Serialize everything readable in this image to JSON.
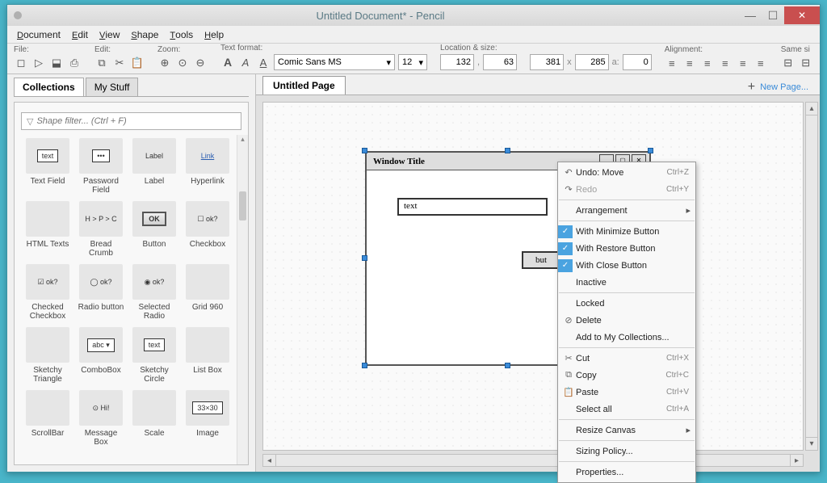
{
  "title": "Untitled Document* - Pencil",
  "menubar": [
    "Document",
    "Edit",
    "View",
    "Shape",
    "Tools",
    "Help"
  ],
  "toolbar": {
    "groups": {
      "file": "File:",
      "edit": "Edit:",
      "zoom": "Zoom:",
      "text": "Text format:",
      "location": "Location & size:",
      "alignment": "Alignment:",
      "samesize": "Same si"
    },
    "font": "Comic Sans MS",
    "fontsize": "12",
    "loc_x": "132",
    "loc_y": "63",
    "size_w": "381",
    "size_h": "285",
    "angle": "0"
  },
  "left": {
    "tabs": [
      "Collections",
      "My Stuff"
    ],
    "filter_placeholder": "Shape filter... (Ctrl + F)",
    "shapes": [
      {
        "label": "Text Field",
        "txt": "text"
      },
      {
        "label": "Password Field",
        "txt": "•••"
      },
      {
        "label": "Label",
        "txt": "Label"
      },
      {
        "label": "Hyperlink",
        "txt": "Link",
        "link": true
      },
      {
        "label": "HTML Texts"
      },
      {
        "label": "Bread Crumb",
        "txt": "H > P > C"
      },
      {
        "label": "Button",
        "txt": "OK",
        "btn": true
      },
      {
        "label": "Checkbox",
        "txt": "☐ ok?"
      },
      {
        "label": "Checked Checkbox",
        "txt": "☑ ok?"
      },
      {
        "label": "Radio button",
        "txt": "◯ ok?"
      },
      {
        "label": "Selected Radio",
        "txt": "◉ ok?"
      },
      {
        "label": "Grid 960"
      },
      {
        "label": "Sketchy Triangle"
      },
      {
        "label": "ComboBox",
        "txt": "abc ▾"
      },
      {
        "label": "Sketchy Circle",
        "txt": "text"
      },
      {
        "label": "List Box"
      },
      {
        "label": "ScrollBar"
      },
      {
        "label": "Message Box",
        "txt": "⊙ Hi!"
      },
      {
        "label": "Scale"
      },
      {
        "label": "Image",
        "txt": "33×30"
      }
    ]
  },
  "canvas": {
    "page_tab": "Untitled Page",
    "new_page": "New Page...",
    "window_title": "Window Title",
    "text_value": "text",
    "button_label": "but"
  },
  "ctx": {
    "undo": "Undo: Move",
    "undo_sc": "Ctrl+Z",
    "redo": "Redo",
    "redo_sc": "Ctrl+Y",
    "arrangement": "Arrangement",
    "minimize": "With Minimize Button",
    "restore": "With Restore Button",
    "close": "With Close Button",
    "inactive": "Inactive",
    "locked": "Locked",
    "delete": "Delete",
    "addcoll": "Add to My Collections...",
    "cut": "Cut",
    "cut_sc": "Ctrl+X",
    "copy": "Copy",
    "copy_sc": "Ctrl+C",
    "paste": "Paste",
    "paste_sc": "Ctrl+V",
    "selectall": "Select all",
    "selectall_sc": "Ctrl+A",
    "resize": "Resize Canvas",
    "sizing": "Sizing Policy...",
    "props": "Properties..."
  }
}
